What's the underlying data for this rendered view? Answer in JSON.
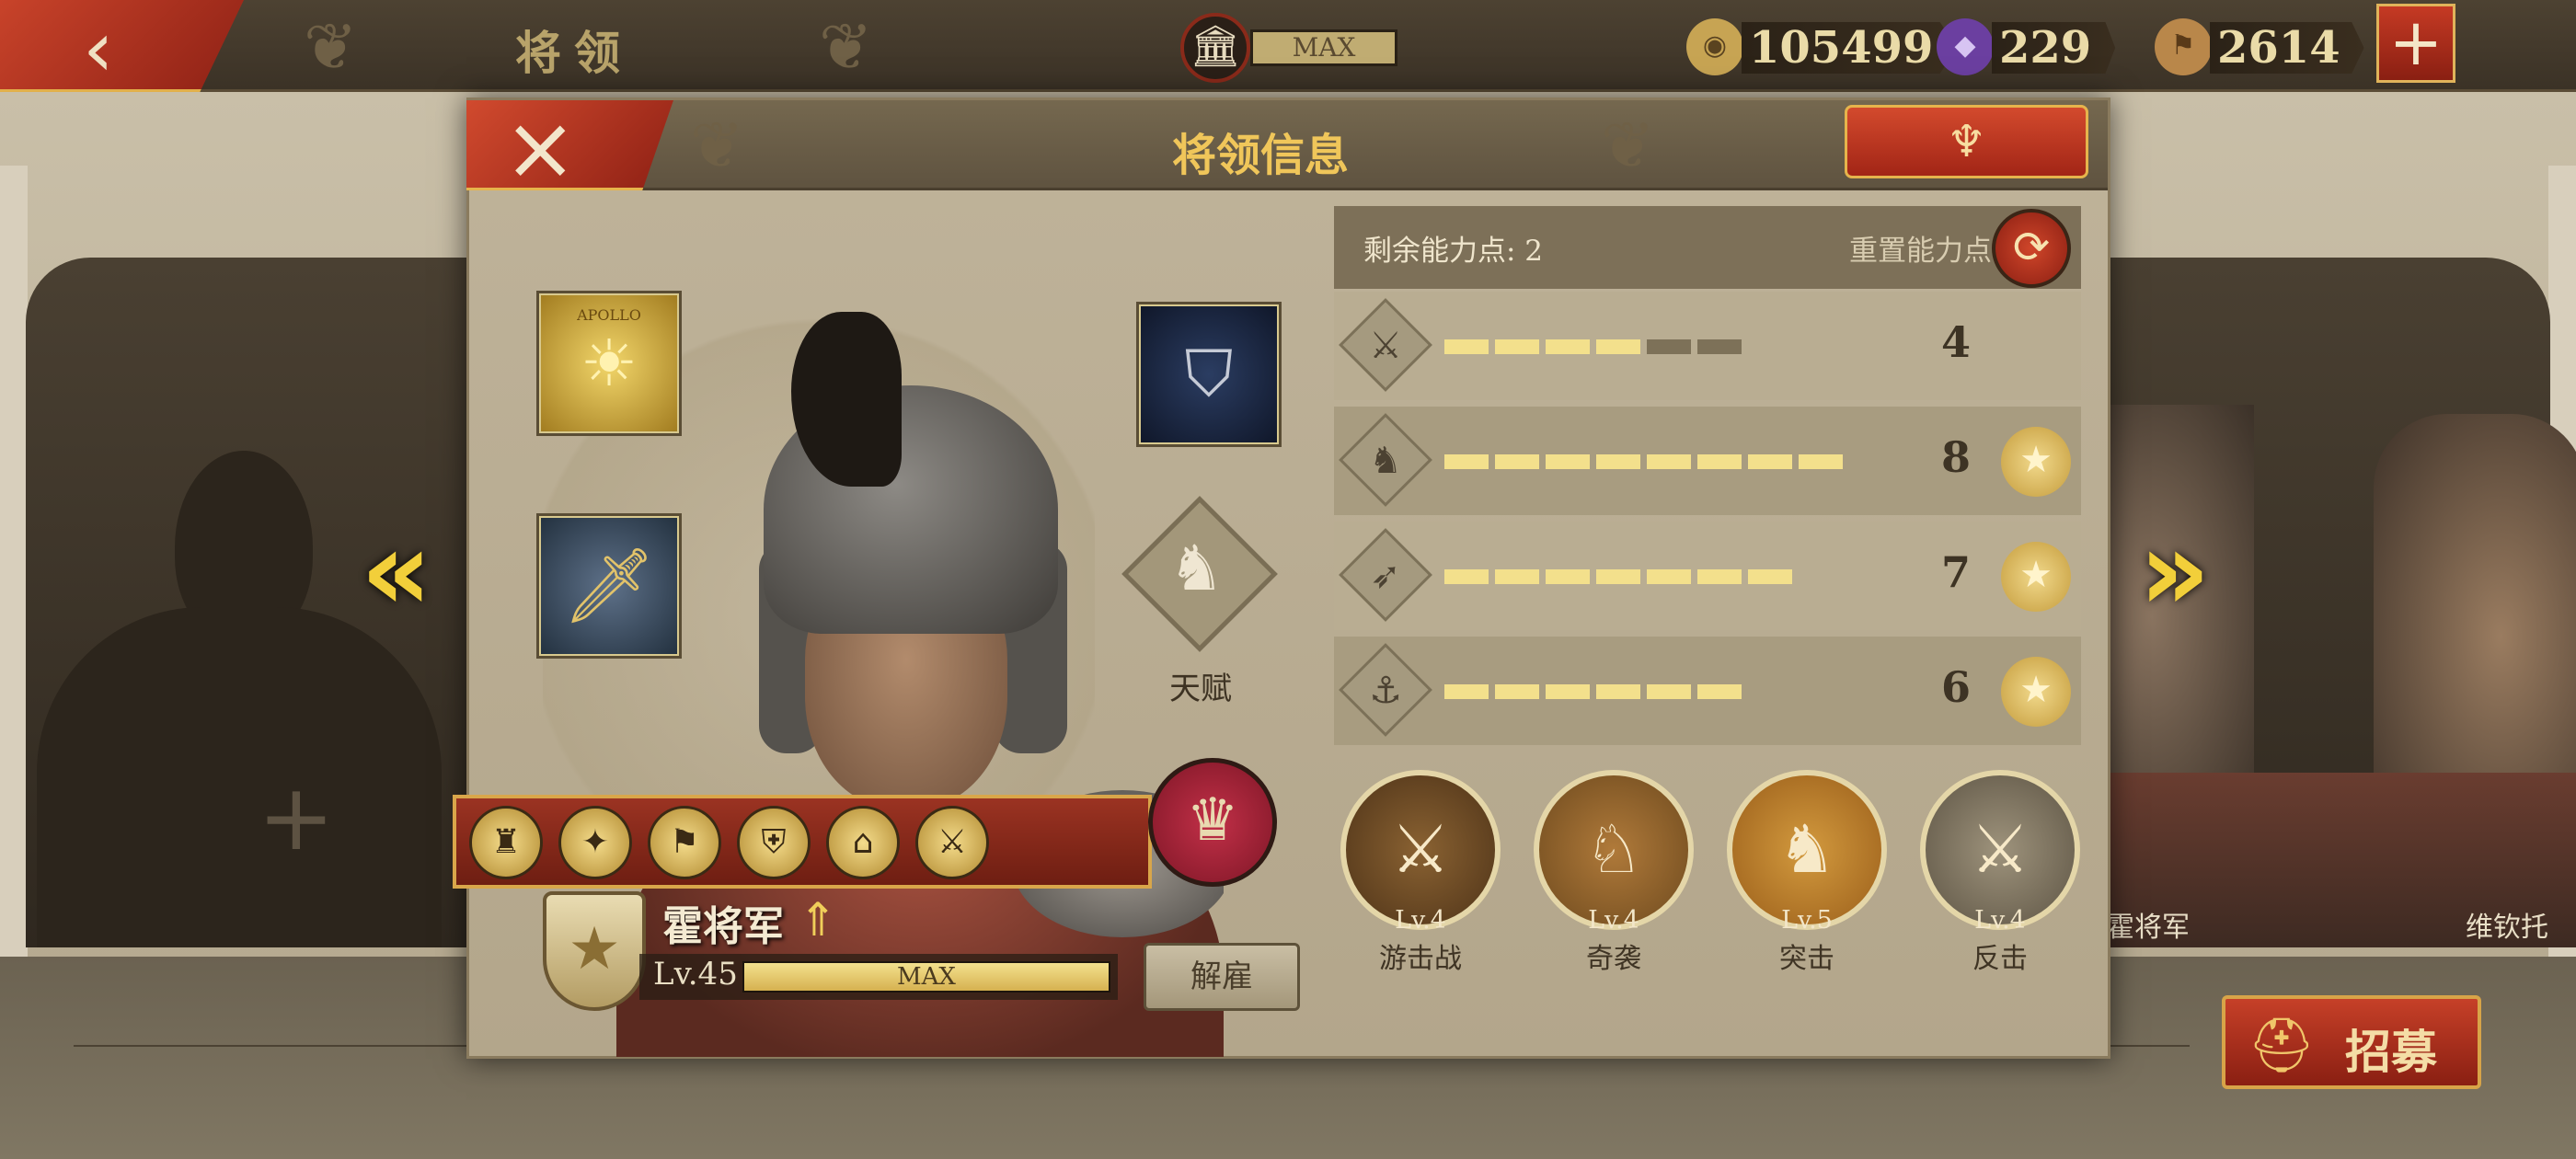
{
  "top_bar": {
    "back_icon": "back-arrow-icon",
    "title": "将领",
    "treasury": {
      "icon": "building-icon",
      "status": "MAX"
    },
    "resources": [
      {
        "name": "coin",
        "icon": "coin-icon",
        "value": "105499",
        "color": "#c7a453"
      },
      {
        "name": "gem",
        "icon": "gem-icon",
        "value": "229",
        "color": "#6b3fa0"
      },
      {
        "name": "banner",
        "icon": "spqr-banner-icon",
        "value": "2614",
        "color": "#b9874a"
      }
    ],
    "add_icon": "plus-icon"
  },
  "background": {
    "empty_slot_icon": "plus-icon",
    "right_general_names": [
      "霍将军",
      "维钦托"
    ]
  },
  "modal": {
    "title": "将领信息",
    "close_icon": "close-icon",
    "emblem_icon": "eagle-emblem-icon",
    "equipment": [
      {
        "slot": "banner",
        "icon": "apollo-banner-icon",
        "label": "APOLLO"
      },
      {
        "slot": "sword",
        "icon": "sword-icon"
      },
      {
        "slot": "shield",
        "icon": "lightning-shield-icon"
      }
    ],
    "talent": {
      "icon": "horse-head-icon",
      "label": "天赋"
    },
    "medals": [
      "eagle-medal-icon",
      "compass-medal-icon",
      "banner-medal-icon",
      "shield-medal-icon",
      "temple-medal-icon",
      "soldier-medal-icon"
    ],
    "crown_icon": "crown-icon",
    "general": {
      "name": "霍将军",
      "level_label": "Lv.45",
      "level_progress": 1.0,
      "level_status": "MAX",
      "dismiss_label": "解雇"
    },
    "stats": {
      "remaining_points": "剩余能力点: 2",
      "reset_label": "重置能力点",
      "reset_icon": "refresh-icon",
      "rows": [
        {
          "icon": "sword-icon",
          "value": "4",
          "filled": 4,
          "total": 6,
          "star": false
        },
        {
          "icon": "horse-icon",
          "value": "8",
          "filled": 8,
          "total": 8,
          "star": true
        },
        {
          "icon": "bow-icon",
          "value": "7",
          "filled": 7,
          "total": 7,
          "star": true
        },
        {
          "icon": "anchor-icon",
          "value": "6",
          "filled": 6,
          "total": 6,
          "star": true
        }
      ]
    },
    "troop_skills": [
      {
        "name": "游击战",
        "level": "Lv.4",
        "icon": "skirmish-icon",
        "color": "#6b4a2a"
      },
      {
        "name": "奇袭",
        "level": "Lv.4",
        "icon": "raid-chariot-icon",
        "color": "#8a6232"
      },
      {
        "name": "突击",
        "level": "Lv.5",
        "icon": "cavalry-charge-icon",
        "color": "#b87a2a"
      },
      {
        "name": "反击",
        "level": "Lv.4",
        "icon": "counterattack-icon",
        "color": "#857a66"
      }
    ]
  },
  "recruit": {
    "label": "招募",
    "icon": "helmet-plus-icon"
  }
}
